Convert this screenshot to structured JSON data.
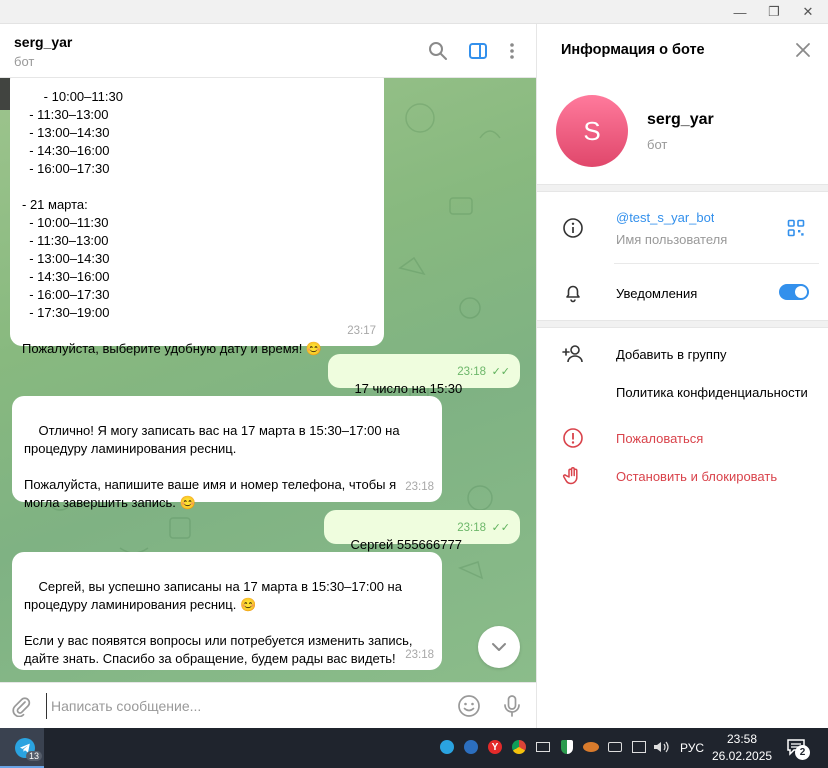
{
  "window": {
    "minimize": "—",
    "restore": "❐",
    "close": "✕"
  },
  "chat": {
    "title": "serg_yar",
    "subtitle": "бот"
  },
  "messages": [
    {
      "text": "  - 10:00–11:30\n  - 11:30–13:00\n  - 13:00–14:30\n  - 14:30–16:00\n  - 16:00–17:30\n\n- 21 марта:\n  - 10:00–11:30\n  - 11:30–13:00\n  - 13:00–14:30\n  - 14:30–16:00\n  - 16:00–17:30\n  - 17:30–19:00\n\nПожалуйста, выберите удобную дату и время! 😊",
      "time": "23:17"
    },
    {
      "text": "17 число на 15:30",
      "time": "23:18",
      "ticks": "✓✓"
    },
    {
      "text": "Отлично! Я могу записать вас на 17 марта в 15:30–17:00 на процедуру ламинирования ресниц.\n\nПожалуйста, напишите ваше имя и номер телефона, чтобы я могла завершить запись. 😊",
      "time": "23:18"
    },
    {
      "text": "Сергей 555666777",
      "time": "23:18",
      "ticks": "✓✓"
    },
    {
      "text": "Сергей, вы успешно записаны на 17 марта в 15:30–17:00 на процедуру ламинирования ресниц. 😊\n\nЕсли у вас появятся вопросы или потребуется изменить запись, дайте знать. Спасибо за обращение, будем рады вас видеть!",
      "time": "23:18"
    }
  ],
  "composer": {
    "placeholder": "Написать сообщение..."
  },
  "info": {
    "title": "Информация о боте",
    "avatar_letter": "S",
    "name": "serg_yar",
    "status": "бот",
    "username": "@test_s_yar_bot",
    "username_caption": "Имя пользователя",
    "notifications": "Уведомления",
    "notifications_on": true,
    "add_to_group": "Добавить в группу",
    "privacy_policy": "Политика конфиденциальности",
    "report": "Пожаловаться",
    "stop_block": "Остановить и блокировать"
  },
  "taskbar": {
    "telegram_badge": "13",
    "language": "РУС",
    "time": "23:58",
    "date": "26.02.2025",
    "notif_count": "2"
  },
  "colors": {
    "accent": "#3390ec",
    "avatar_gradient_top": "#ff7a9c",
    "avatar_gradient_bottom": "#e0476b",
    "danger": "#d9434b",
    "outgoing_bubble": "#effdde"
  }
}
